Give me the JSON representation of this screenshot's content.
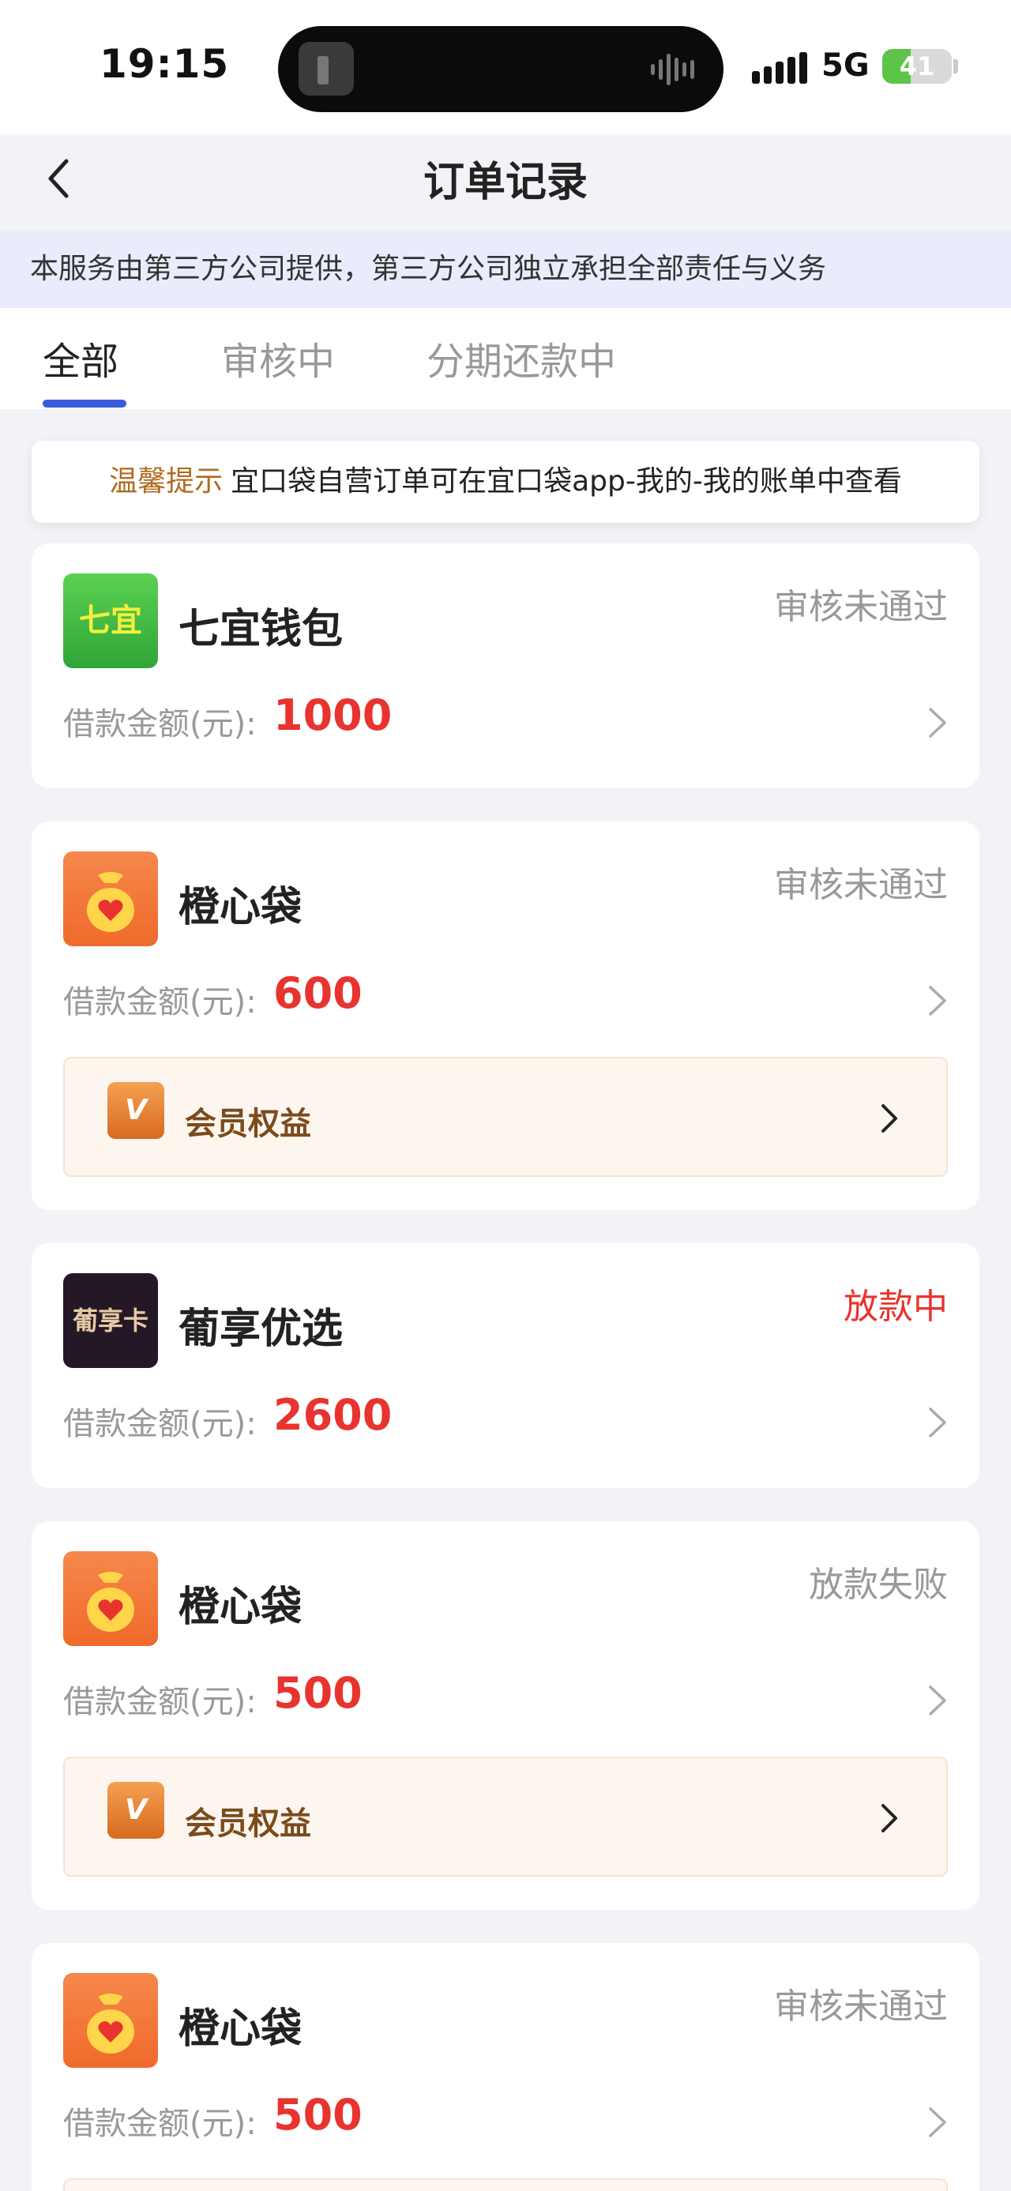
{
  "status_bar": {
    "time": "19:15",
    "network": "5G",
    "battery_percent": 41,
    "battery_label": "41"
  },
  "header": {
    "title": "订单记录"
  },
  "notice": "本服务由第三方公司提供，第三方公司独立承担全部责任与义务",
  "tabs": [
    {
      "label": "全部",
      "active": true
    },
    {
      "label": "审核中",
      "active": false
    },
    {
      "label": "分期还款中",
      "active": false
    }
  ],
  "tip": {
    "label": "温馨提示",
    "text": "宜口袋自营订单可在宜口袋app-我的-我的账单中查看"
  },
  "orders": [
    {
      "name": "七宜钱包",
      "logo_text": "七宜",
      "status": "审核未通过",
      "amount_label": "借款金额(元):",
      "amount": "1000"
    },
    {
      "name": "橙心袋",
      "status": "审核未通过",
      "amount_label": "借款金额(元):",
      "amount": "600",
      "vip_label": "会员权益",
      "vip_icon_text": "V"
    },
    {
      "name": "葡享优选",
      "logo_text": "葡享卡",
      "status": "放款中",
      "amount_label": "借款金额(元):",
      "amount": "2600"
    },
    {
      "name": "橙心袋",
      "status": "放款失败",
      "amount_label": "借款金额(元):",
      "amount": "500",
      "vip_label": "会员权益",
      "vip_icon_text": "V"
    },
    {
      "name": "橙心袋",
      "status": "审核未通过",
      "amount_label": "借款金额(元):",
      "amount": "500"
    }
  ],
  "colors": {
    "accent": "#3b5bdb",
    "amount": "#e8332f",
    "status_red": "#e8332f",
    "notice_bg": "#e9ecfb"
  }
}
